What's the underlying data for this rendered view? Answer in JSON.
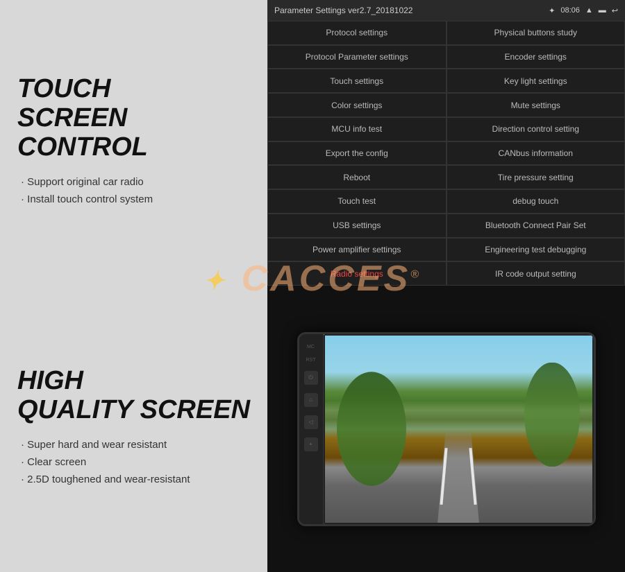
{
  "top": {
    "left": {
      "title_line1": "TOUCH",
      "title_line2": "SCREEN CONTROL",
      "features": [
        "Support original car radio",
        "Install touch control system"
      ]
    },
    "right": {
      "header": {
        "title": "Parameter Settings ver2.7_20181022",
        "time": "08:06",
        "icons": [
          "✦",
          "▲",
          "▬",
          "↩"
        ]
      },
      "settings": [
        [
          "Protocol settings",
          "Physical buttons study"
        ],
        [
          "Protocol Parameter settings",
          "Encoder settings"
        ],
        [
          "Touch settings",
          "Key light settings"
        ],
        [
          "Color settings",
          "Mute settings"
        ],
        [
          "MCU info test",
          "Direction control setting"
        ],
        [
          "Export the config",
          "CANbus information"
        ],
        [
          "Reboot",
          "Tire pressure setting"
        ],
        [
          "Touch test",
          "debug touch"
        ],
        [
          "USB settings",
          "Bluetooth Connect Pair Set"
        ],
        [
          "Power amplifier settings",
          "Engineering test debugging"
        ],
        [
          "Radio settings",
          "IR code output setting"
        ]
      ]
    }
  },
  "watermark": {
    "text": "CACCES",
    "symbol": "®"
  },
  "bottom": {
    "left": {
      "title_line1": "HIGH",
      "title_line2": "QUALITY SCREEN",
      "features": [
        "Super hard and wear resistant",
        "Clear screen",
        "2.5D toughened and wear-resistant"
      ]
    },
    "right": {
      "device": {
        "side_labels": [
          "MC",
          "RST"
        ],
        "side_buttons": [
          "⏻",
          "⌂",
          "◁",
          "⁺"
        ],
        "alt_text": "Car radio with road landscape screen"
      }
    }
  }
}
